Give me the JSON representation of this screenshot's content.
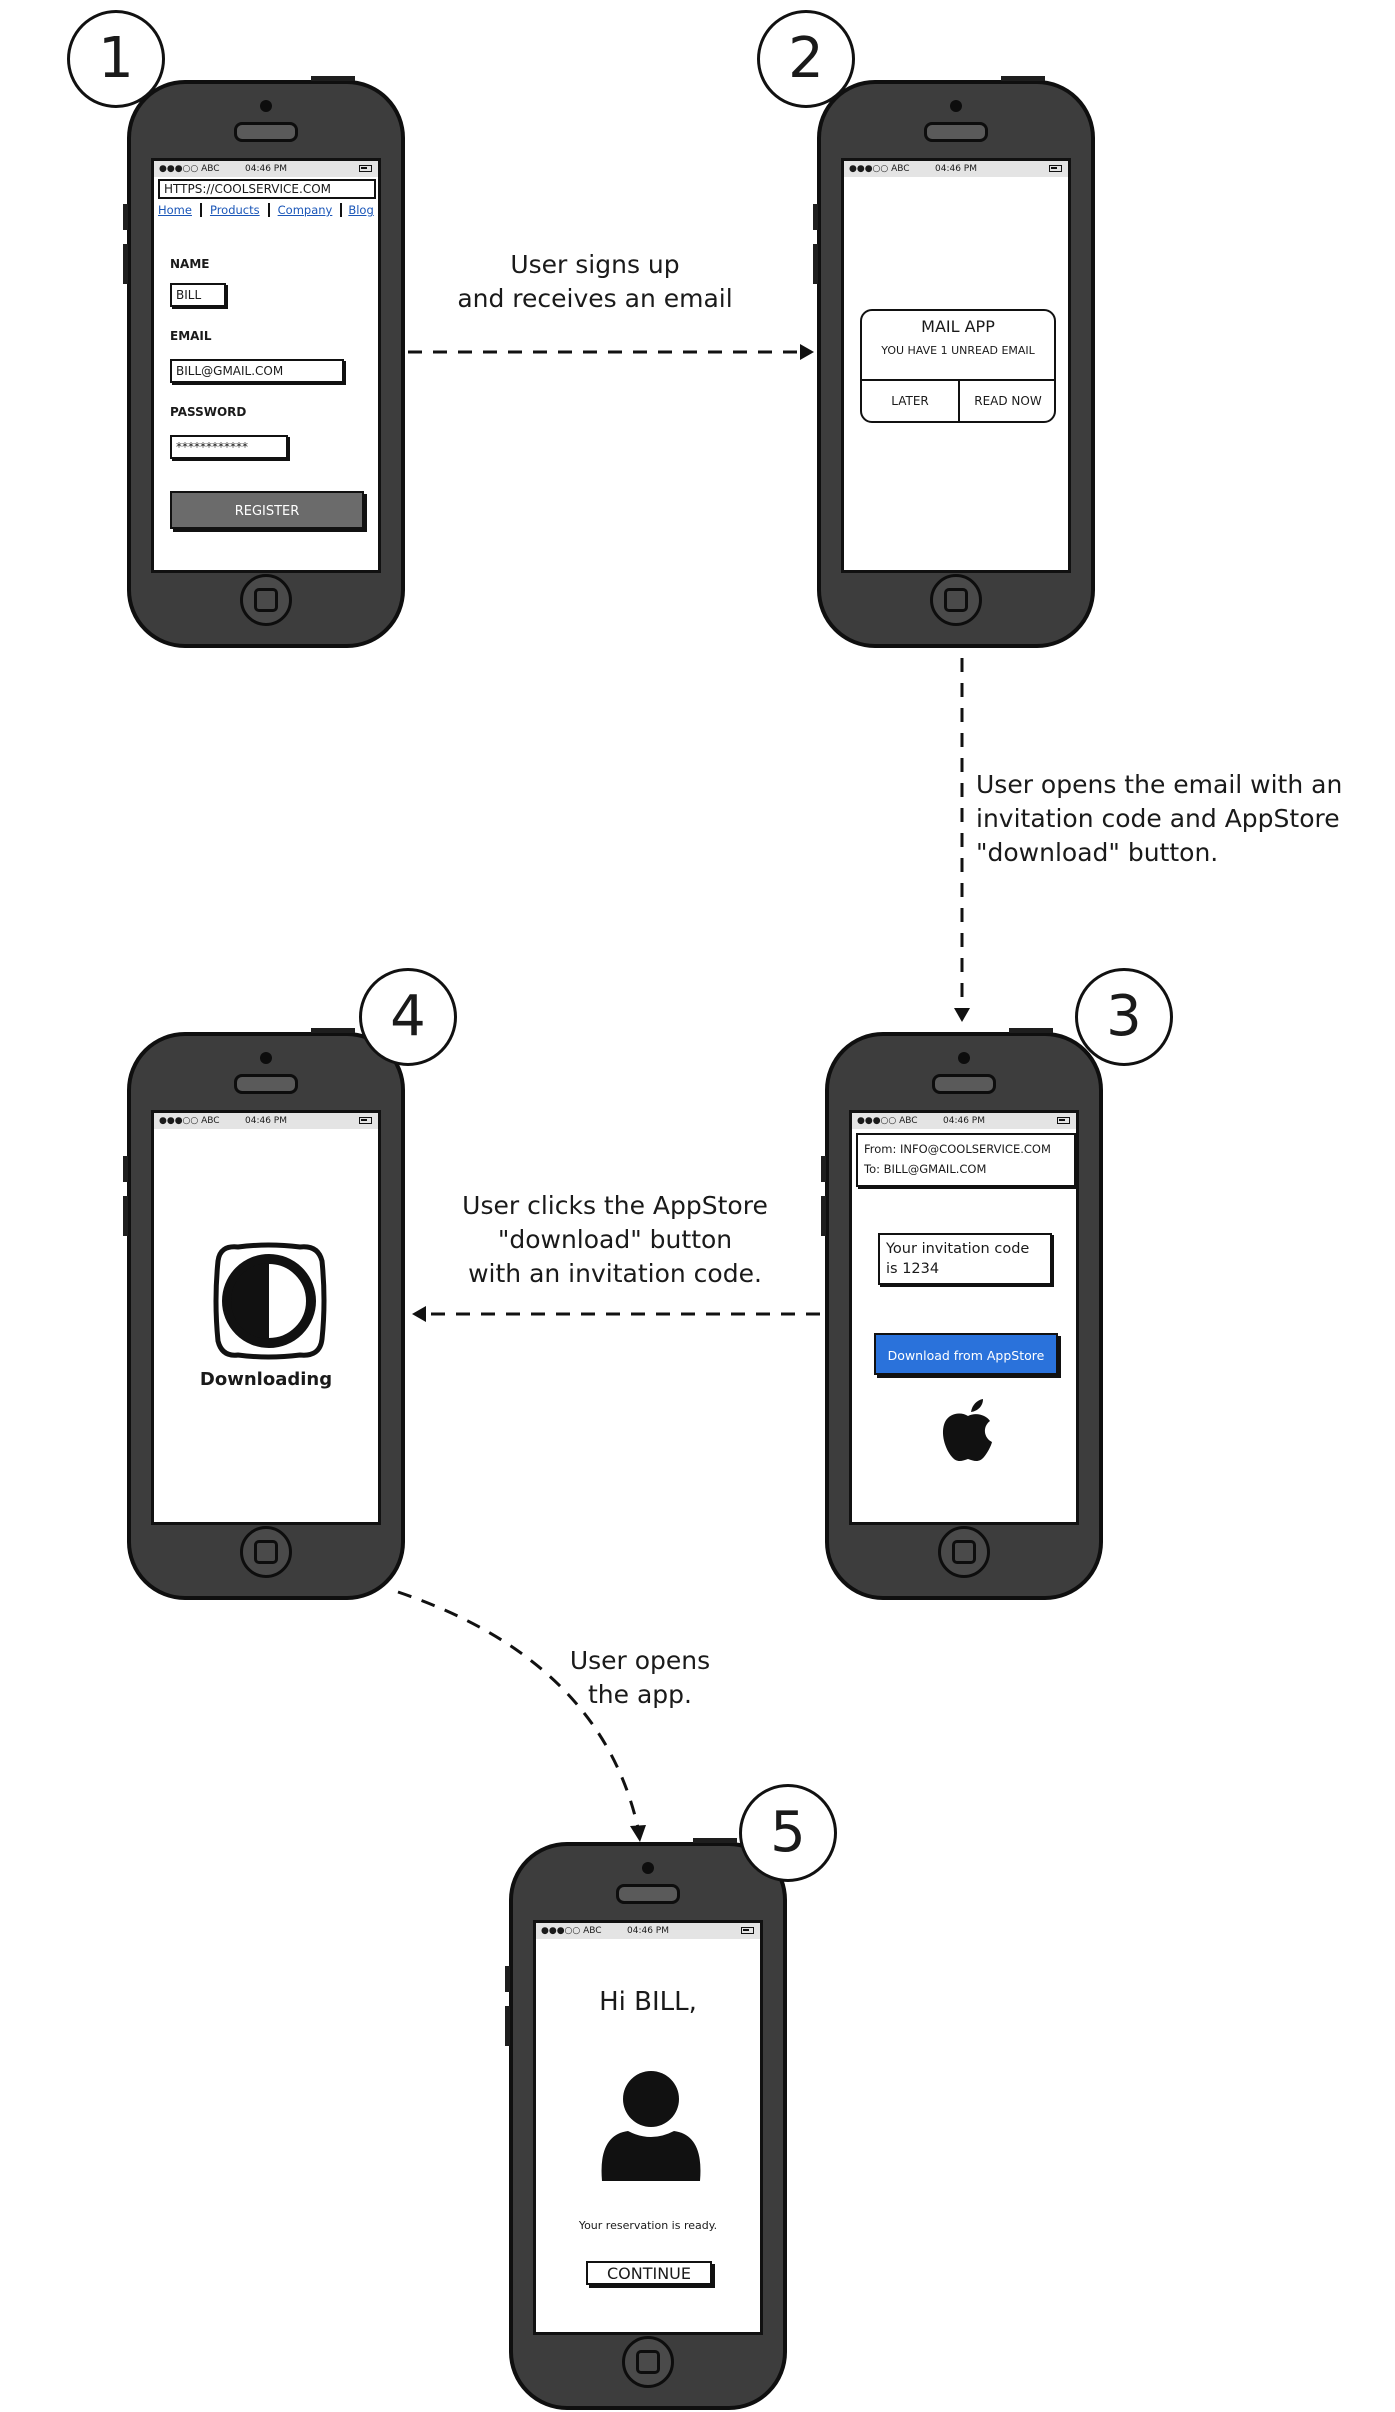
{
  "status_bar": {
    "signal": "●●●○○ ABC",
    "time": "04:46 PM"
  },
  "steps": [
    "1",
    "2",
    "3",
    "4",
    "5"
  ],
  "phone1": {
    "url": "HTTPS://COOLSERVICE.COM",
    "nav": [
      "Home",
      "Products",
      "Company",
      "Blog"
    ],
    "name_label": "NAME",
    "name_value": "BILL",
    "email_label": "EMAIL",
    "email_value": "BILL@GMAIL.COM",
    "password_label": "PASSWORD",
    "password_value": "************",
    "register_label": "REGISTER"
  },
  "phone2": {
    "alert_title": "MAIL APP",
    "alert_message": "YOU HAVE 1 UNREAD EMAIL",
    "later_label": "LATER",
    "read_now_label": "READ NOW"
  },
  "phone3": {
    "from": "From: INFO@COOLSERVICE.COM",
    "to": "To: BILL@GMAIL.COM",
    "invite_line1": "Your invitation code",
    "invite_line2": "is 1234",
    "download_label": "Download from AppStore",
    "logo_icon": "apple-logo-icon",
    "download_color": "#2a72db"
  },
  "phone4": {
    "status_label": "Downloading",
    "icon": "half-circle-app-icon"
  },
  "phone5": {
    "greeting": "Hi BILL,",
    "avatar_icon": "user-avatar-icon",
    "message": "Your reservation is ready.",
    "continue_label": "CONTINUE"
  },
  "annotations": {
    "a12": [
      "User signs up",
      "and receives an email"
    ],
    "a23": [
      "User opens the email with an",
      "invitation code and AppStore",
      "\"download\" button."
    ],
    "a34": [
      "User clicks the AppStore",
      "\"download\" button",
      "with an invitation code."
    ],
    "a45": [
      "User opens",
      "the app."
    ]
  }
}
